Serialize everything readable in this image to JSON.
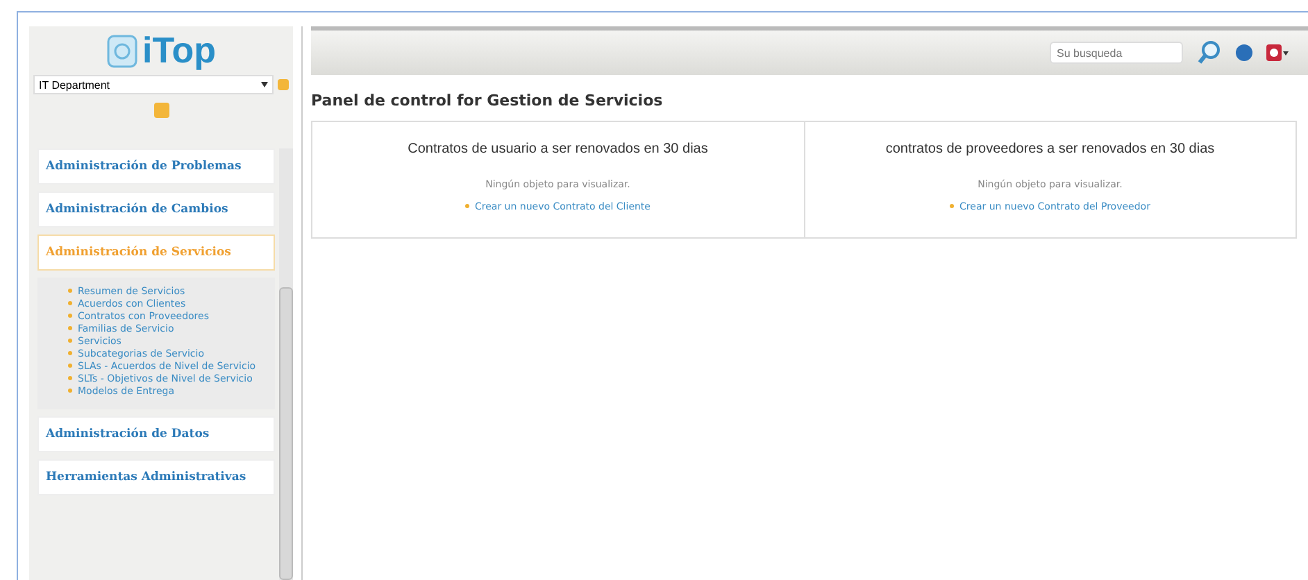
{
  "sidebar": {
    "logo": "iTop",
    "organization": "IT Department",
    "menus": [
      {
        "label": "Administración de Problemas",
        "selected": false
      },
      {
        "label": "Administración de Cambios",
        "selected": false
      },
      {
        "label": "Administración de Servicios",
        "selected": true,
        "items": [
          "Resumen de Servicios",
          "Acuerdos con Clientes",
          "Contratos con Proveedores",
          "Familias de Servicio",
          "Servicios",
          "Subcategorias de Servicio",
          "SLAs - Acuerdos de Nivel de Servicio",
          "SLTs - Objetivos de Nivel de Servicio",
          "Modelos de Entrega"
        ]
      },
      {
        "label": "Administración de Datos",
        "selected": false
      },
      {
        "label": "Herramientas Administrativas",
        "selected": false
      }
    ]
  },
  "toolbar": {
    "search": {
      "placeholder": "Su busqueda"
    }
  },
  "page_title": "Panel de control for Gestion de Servicios",
  "cards": [
    {
      "title": "Contratos de usuario a ser renovados en 30 dias",
      "message": "Ningún objeto para visualizar.",
      "link": "Crear un nuevo Contrato del Cliente"
    },
    {
      "title": "contratos de proveedores a ser renovados en 30 dias",
      "message": "Ningún objeto para visualizar.",
      "link": "Crear un nuevo Contrato del Proveedor"
    }
  ]
}
